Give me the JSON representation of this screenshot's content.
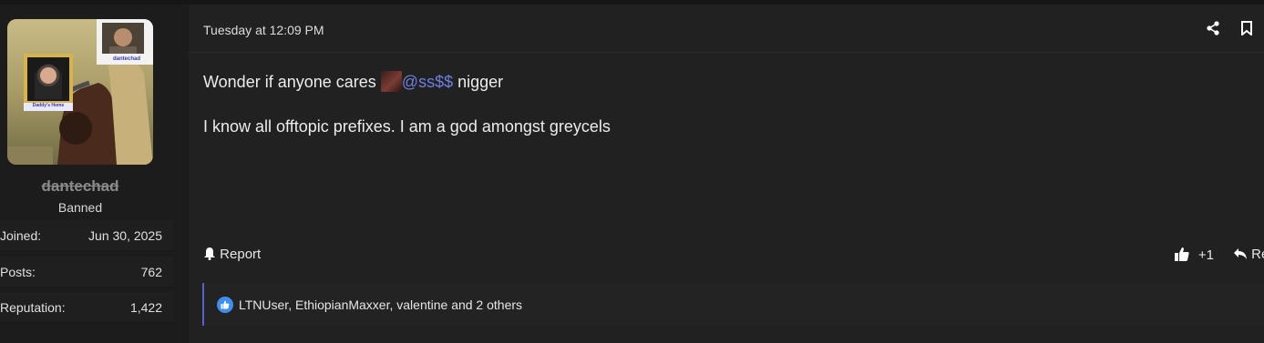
{
  "colors": {
    "accent": "#5a5fd0",
    "mention": "#6f7fe0",
    "like": "#3e8ef0"
  },
  "user": {
    "name": "dantechad",
    "title": "Banned",
    "avatar_badge_top": "dantechad",
    "avatar_badge_left": "Daddy's Home",
    "stats": [
      {
        "label": "Joined:",
        "value": "Jun 30, 2025"
      },
      {
        "label": "Posts:",
        "value": "762"
      },
      {
        "label": "Reputation:",
        "value": "1,422"
      }
    ]
  },
  "post": {
    "date": "Tuesday at 12:09 PM",
    "line1_prefix": "Wonder if anyone cares",
    "mention": "@ss$$",
    "line1_suffix": "nigger",
    "line2": "I know all offtopic prefixes. I am a god amongst greycels",
    "report_label": "Report",
    "plus_one_label": "+1",
    "reply_label": "Re",
    "reactions_text": "LTNUser, EthiopianMaxxer, valentine and 2 others"
  },
  "icons": {
    "share": "share-icon",
    "bookmark": "bookmark-icon",
    "report": "bell-icon",
    "like": "thumbs-up-icon",
    "reply": "reply-icon"
  }
}
